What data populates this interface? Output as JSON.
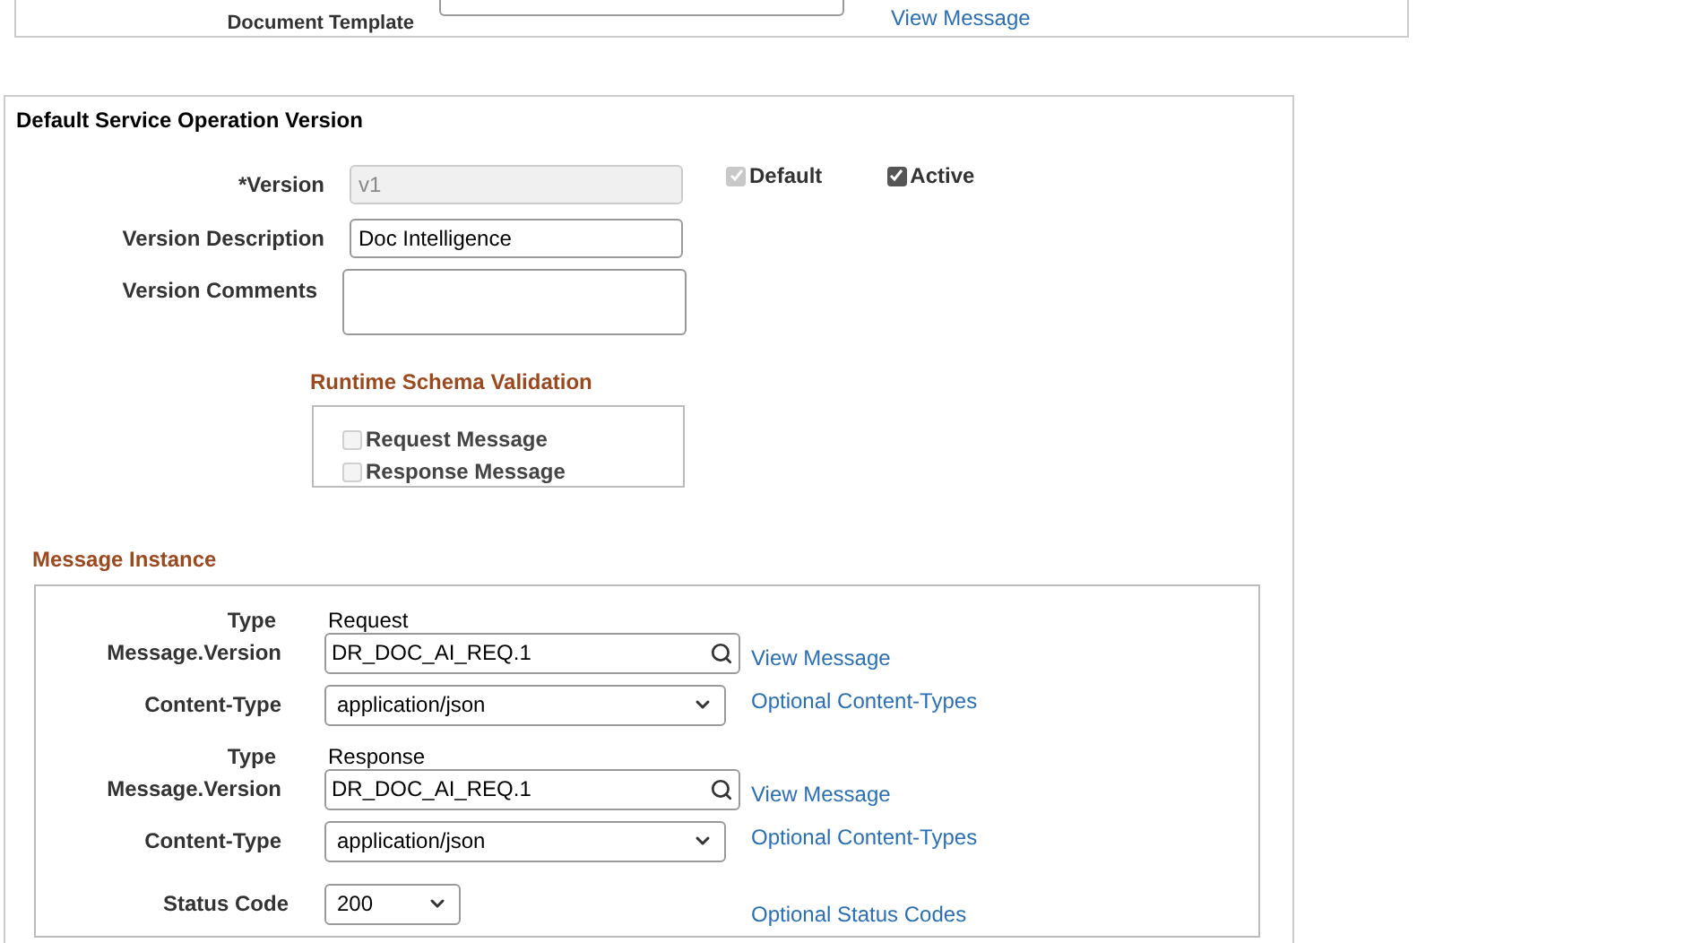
{
  "top_panel": {
    "label": "Document Template",
    "link": "View Message"
  },
  "version_panel": {
    "title": "Default Service Operation Version",
    "version": {
      "label": "*Version",
      "value": "v1",
      "disabled": true
    },
    "default": {
      "label": "Default",
      "checked": true,
      "disabled": true
    },
    "active": {
      "label": "Active",
      "checked": true,
      "disabled": false
    },
    "description": {
      "label": "Version Description",
      "value": "Doc Intelligence"
    },
    "comments": {
      "label": "Version Comments"
    },
    "schema_validation": {
      "title": "Runtime Schema Validation",
      "options": [
        {
          "label": "Request Message",
          "checked": false,
          "disabled": true
        },
        {
          "label": "Response Message",
          "checked": false,
          "disabled": true
        }
      ]
    }
  },
  "message_instance": {
    "title": "Message Instance",
    "instances": [
      {
        "type_label": "Type",
        "type": "Request",
        "message_label": "Message.Version",
        "message": "DR_DOC_AI_REQ.1",
        "message_link": "View Message",
        "content_label": "Content-Type",
        "content_type": "application/json",
        "content_link": "Optional Content-Types"
      },
      {
        "type_label": "Type",
        "type": "Response",
        "message_label": "Message.Version",
        "message": "DR_DOC_AI_REQ.1",
        "message_link": "View Message",
        "content_label": "Content-Type",
        "content_type": "application/json",
        "content_link": "Optional Content-Types"
      }
    ],
    "status": {
      "label": "Status Code",
      "value": "200",
      "link": "Optional Status Codes"
    }
  }
}
